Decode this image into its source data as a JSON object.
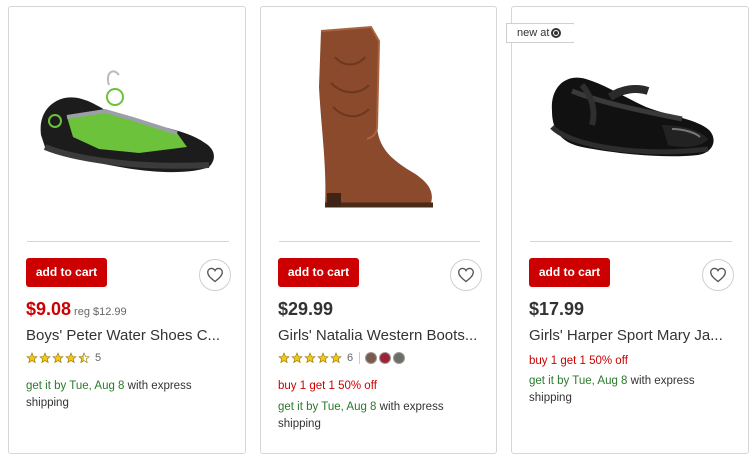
{
  "products": [
    {
      "image_icon": "water-shoe-image",
      "add_to_cart_label": "add to cart",
      "price": "$9.08",
      "reg_price": "reg $12.99",
      "title": "Boys' Peter Water Shoes C...",
      "rating_stars": 4.5,
      "rating_count": "5",
      "promo": "",
      "shipping_prefix": "get it by Tue, Aug 8",
      "shipping_suffix": " with express shipping"
    },
    {
      "image_icon": "western-boot-image",
      "add_to_cart_label": "add to cart",
      "price": "$29.99",
      "reg_price": "",
      "title": "Girls' Natalia Western Boots...",
      "rating_stars": 5,
      "rating_count": "6",
      "swatches": [
        "#7a5a4a",
        "#9b2335",
        "#6e6e66"
      ],
      "promo": "buy 1 get 1 50% off",
      "shipping_prefix": "get it by Tue, Aug 8",
      "shipping_suffix": " with express shipping"
    },
    {
      "image_icon": "mary-jane-shoe-image",
      "badge": "new at",
      "add_to_cart_label": "add to cart",
      "price": "$17.99",
      "reg_price": "",
      "title": "Girls' Harper Sport Mary Ja...",
      "promo": "buy 1 get 1 50% off",
      "shipping_prefix": "get it by Tue, Aug 8",
      "shipping_suffix": " with express shipping"
    }
  ],
  "colors": {
    "brand_red": "#cc0000",
    "star_yellow": "#f5c518",
    "shipping_green": "#2a7a2a"
  }
}
